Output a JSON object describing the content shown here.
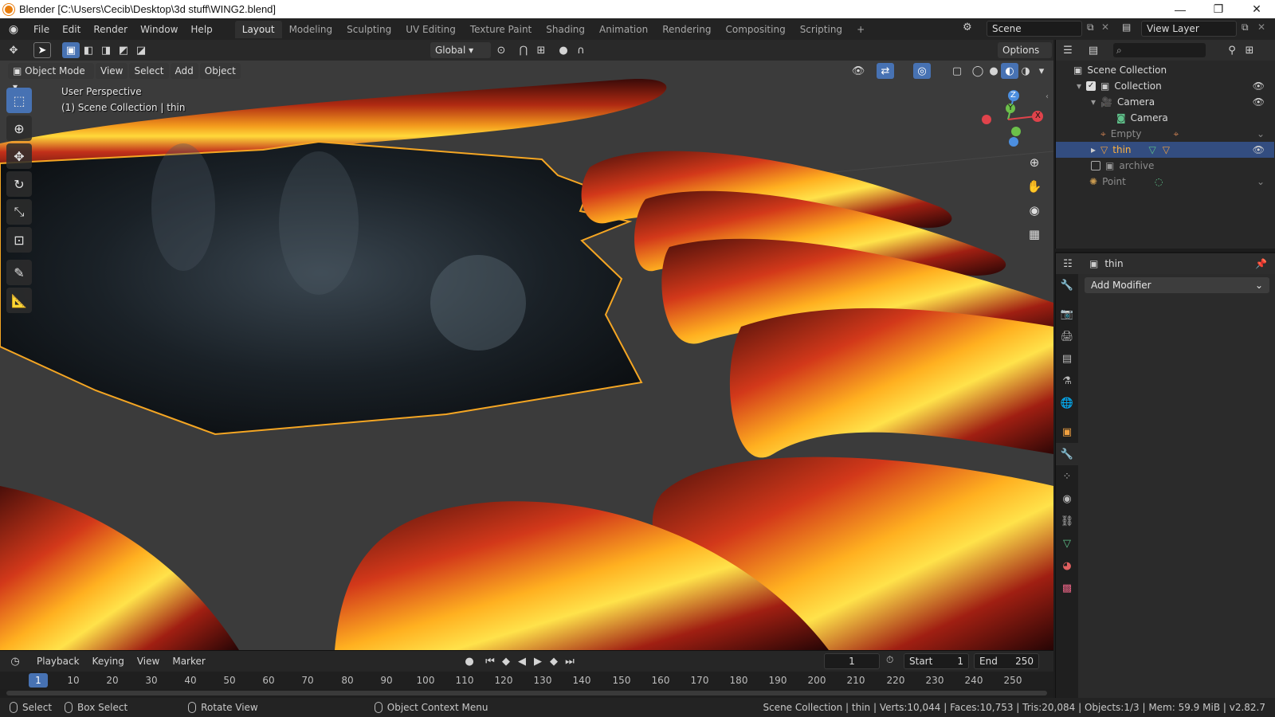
{
  "window": {
    "title": "Blender [C:\\Users\\Cecib\\Desktop\\3d stuff\\WING2.blend]",
    "minimize": "—",
    "maximize": "❐",
    "close": "✕"
  },
  "menu": {
    "items": [
      "File",
      "Edit",
      "Render",
      "Window",
      "Help"
    ]
  },
  "workspaces": {
    "tabs": [
      "Layout",
      "Modeling",
      "Sculpting",
      "UV Editing",
      "Texture Paint",
      "Shading",
      "Animation",
      "Rendering",
      "Compositing",
      "Scripting"
    ],
    "active": "Layout",
    "add": "+"
  },
  "scene": {
    "scene_name": "Scene",
    "view_layer": "View Layer"
  },
  "viewport": {
    "orientation": "Global",
    "options": "Options",
    "mode": "Object Mode",
    "header_menus": [
      "View",
      "Select",
      "Add",
      "Object"
    ],
    "perspective": "User Perspective",
    "collection_info": "(1) Scene Collection | thin",
    "gizmo": {
      "z": "Z",
      "y": "Y",
      "x": "X"
    }
  },
  "timeline": {
    "menus": [
      "Playback",
      "Keying",
      "View",
      "Marker"
    ],
    "current_frame": "1",
    "start_label": "Start",
    "start_value": "1",
    "end_label": "End",
    "end_value": "250",
    "ticks": [
      "1",
      "10",
      "20",
      "30",
      "40",
      "50",
      "60",
      "70",
      "80",
      "90",
      "100",
      "110",
      "120",
      "130",
      "140",
      "150",
      "160",
      "170",
      "180",
      "190",
      "200",
      "210",
      "220",
      "230",
      "240",
      "250"
    ]
  },
  "status": {
    "select": "Select",
    "box_select": "Box Select",
    "rotate_view": "Rotate View",
    "context_menu": "Object Context Menu",
    "stats": "Scene Collection | thin | Verts:10,044 | Faces:10,753 | Tris:20,084 | Objects:1/3 | Mem: 59.9 MiB | v2.82.7"
  },
  "outliner": {
    "scene_collection": "Scene Collection",
    "collection": "Collection",
    "camera_obj": "Camera",
    "camera_data": "Camera",
    "empty": "Empty",
    "thin": "thin",
    "archive": "archive",
    "point": "Point"
  },
  "properties": {
    "object_name": "thin",
    "add_modifier": "Add Modifier"
  },
  "colors": {
    "accent": "#4772b3",
    "selection_outline": "#f5a623",
    "background": "#3a3a3a"
  }
}
